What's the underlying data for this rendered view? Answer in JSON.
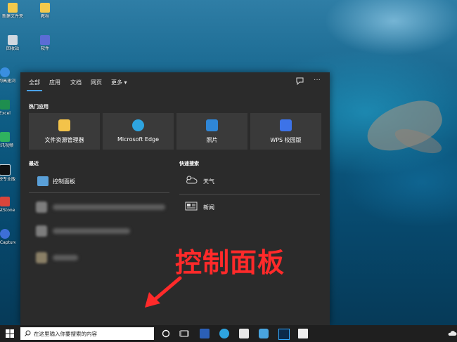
{
  "desktop": {
    "icons": [
      {
        "label": "新建文件夹"
      },
      {
        "label": "教程"
      },
      {
        "label": "回收站"
      },
      {
        "label": "软件"
      },
      {
        "label": "搜狗高速浏览器"
      },
      {
        "label": "Excel"
      },
      {
        "label": "腾讯视频"
      },
      {
        "label": "剪映专业版"
      },
      {
        "label": "FastStone Capture"
      },
      {
        "label": "EVCapture 快捷方式"
      }
    ]
  },
  "panel": {
    "tabs": [
      {
        "label": "全部"
      },
      {
        "label": "应用"
      },
      {
        "label": "文档"
      },
      {
        "label": "网页"
      },
      {
        "label": "更多 ▾"
      }
    ],
    "feedback_icon": "feedback-icon",
    "more_options_icon": "ellipsis-icon",
    "top_apps_title": "热门应用",
    "top_apps": [
      {
        "label": "文件资源管理器",
        "icon": "file-explorer-icon",
        "color": "#f3c34a"
      },
      {
        "label": "Microsoft Edge",
        "icon": "edge-icon",
        "color": "#2ea4e0"
      },
      {
        "label": "照片",
        "icon": "photos-icon",
        "color": "#2f86d6"
      },
      {
        "label": "WPS 校园版",
        "icon": "wps-icon",
        "color": "#3d73e8"
      }
    ],
    "recent_title": "最近",
    "recent_items": [
      {
        "label": "控制面板",
        "icon": "control-panel-icon"
      }
    ],
    "quick_search_title": "快速搜索",
    "quick_search_items": [
      {
        "label": "天气",
        "icon": "weather-icon"
      },
      {
        "label": "新闻",
        "icon": "news-icon"
      }
    ]
  },
  "annotation": {
    "text": "控制面板",
    "color": "#ff2a2a"
  },
  "taskbar": {
    "search_placeholder": "在这里输入你要搜索的内容",
    "apps": [
      {
        "icon": "cortana-icon"
      },
      {
        "icon": "task-view-icon"
      },
      {
        "icon": "word-icon"
      },
      {
        "icon": "edge-icon"
      },
      {
        "icon": "store-icon"
      },
      {
        "icon": "app-icon"
      },
      {
        "icon": "photoshop-icon"
      },
      {
        "icon": "notepad-icon"
      }
    ]
  }
}
